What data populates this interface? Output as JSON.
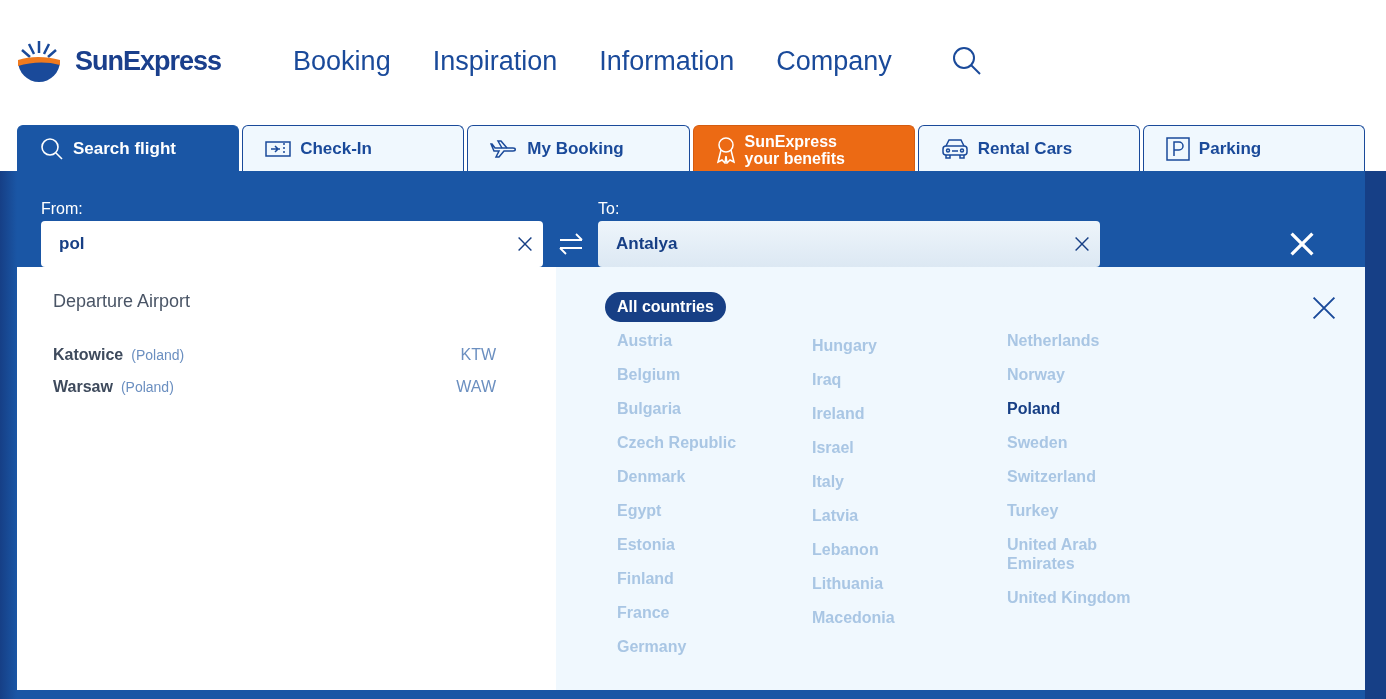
{
  "header": {
    "brand": "SunExpress",
    "nav": [
      "Booking",
      "Inspiration",
      "Information",
      "Company"
    ]
  },
  "tabs": [
    {
      "label": "Search flight",
      "kind": "search",
      "selected": true
    },
    {
      "label": "Check-In",
      "kind": "ticket",
      "selected": false
    },
    {
      "label": "My Booking",
      "kind": "plane",
      "selected": false
    },
    {
      "label": "SunExpress your benefits",
      "kind": "promo",
      "selected": false
    },
    {
      "label": "Rental Cars",
      "kind": "car",
      "selected": false
    },
    {
      "label": "Parking",
      "kind": "parking",
      "selected": false
    }
  ],
  "search": {
    "from": {
      "label": "From:",
      "value": "pol"
    },
    "to": {
      "label": "To:",
      "value": "Antalya"
    }
  },
  "departure": {
    "title": "Departure Airport",
    "airports": [
      {
        "city": "Katowice",
        "country": "(Poland)",
        "code": "KTW"
      },
      {
        "city": "Warsaw",
        "country": "(Poland)",
        "code": "WAW"
      }
    ]
  },
  "countries": {
    "filter": {
      "label": "All countries",
      "selected": true
    },
    "columns": [
      [
        {
          "name": "Austria",
          "selected": false
        },
        {
          "name": "Belgium",
          "selected": false
        },
        {
          "name": "Bulgaria",
          "selected": false
        },
        {
          "name": "Czech Republic",
          "selected": false
        },
        {
          "name": "Denmark",
          "selected": false
        },
        {
          "name": "Egypt",
          "selected": false
        },
        {
          "name": "Estonia",
          "selected": false
        },
        {
          "name": "Finland",
          "selected": false
        },
        {
          "name": "France",
          "selected": false
        },
        {
          "name": "Germany",
          "selected": false
        }
      ],
      [
        {
          "name": "Hungary",
          "selected": false
        },
        {
          "name": "Iraq",
          "selected": false
        },
        {
          "name": "Ireland",
          "selected": false
        },
        {
          "name": "Israel",
          "selected": false
        },
        {
          "name": "Italy",
          "selected": false
        },
        {
          "name": "Latvia",
          "selected": false
        },
        {
          "name": "Lebanon",
          "selected": false
        },
        {
          "name": "Lithuania",
          "selected": false
        },
        {
          "name": "Macedonia",
          "selected": false
        }
      ],
      [
        {
          "name": "Netherlands",
          "selected": false
        },
        {
          "name": "Norway",
          "selected": false
        },
        {
          "name": "Poland",
          "selected": true
        },
        {
          "name": "Sweden",
          "selected": false
        },
        {
          "name": "Switzerland",
          "selected": false
        },
        {
          "name": "Turkey",
          "selected": false
        },
        {
          "name": "United Arab Emirates",
          "selected": false
        },
        {
          "name": "United Kingdom",
          "selected": false
        }
      ]
    ]
  }
}
